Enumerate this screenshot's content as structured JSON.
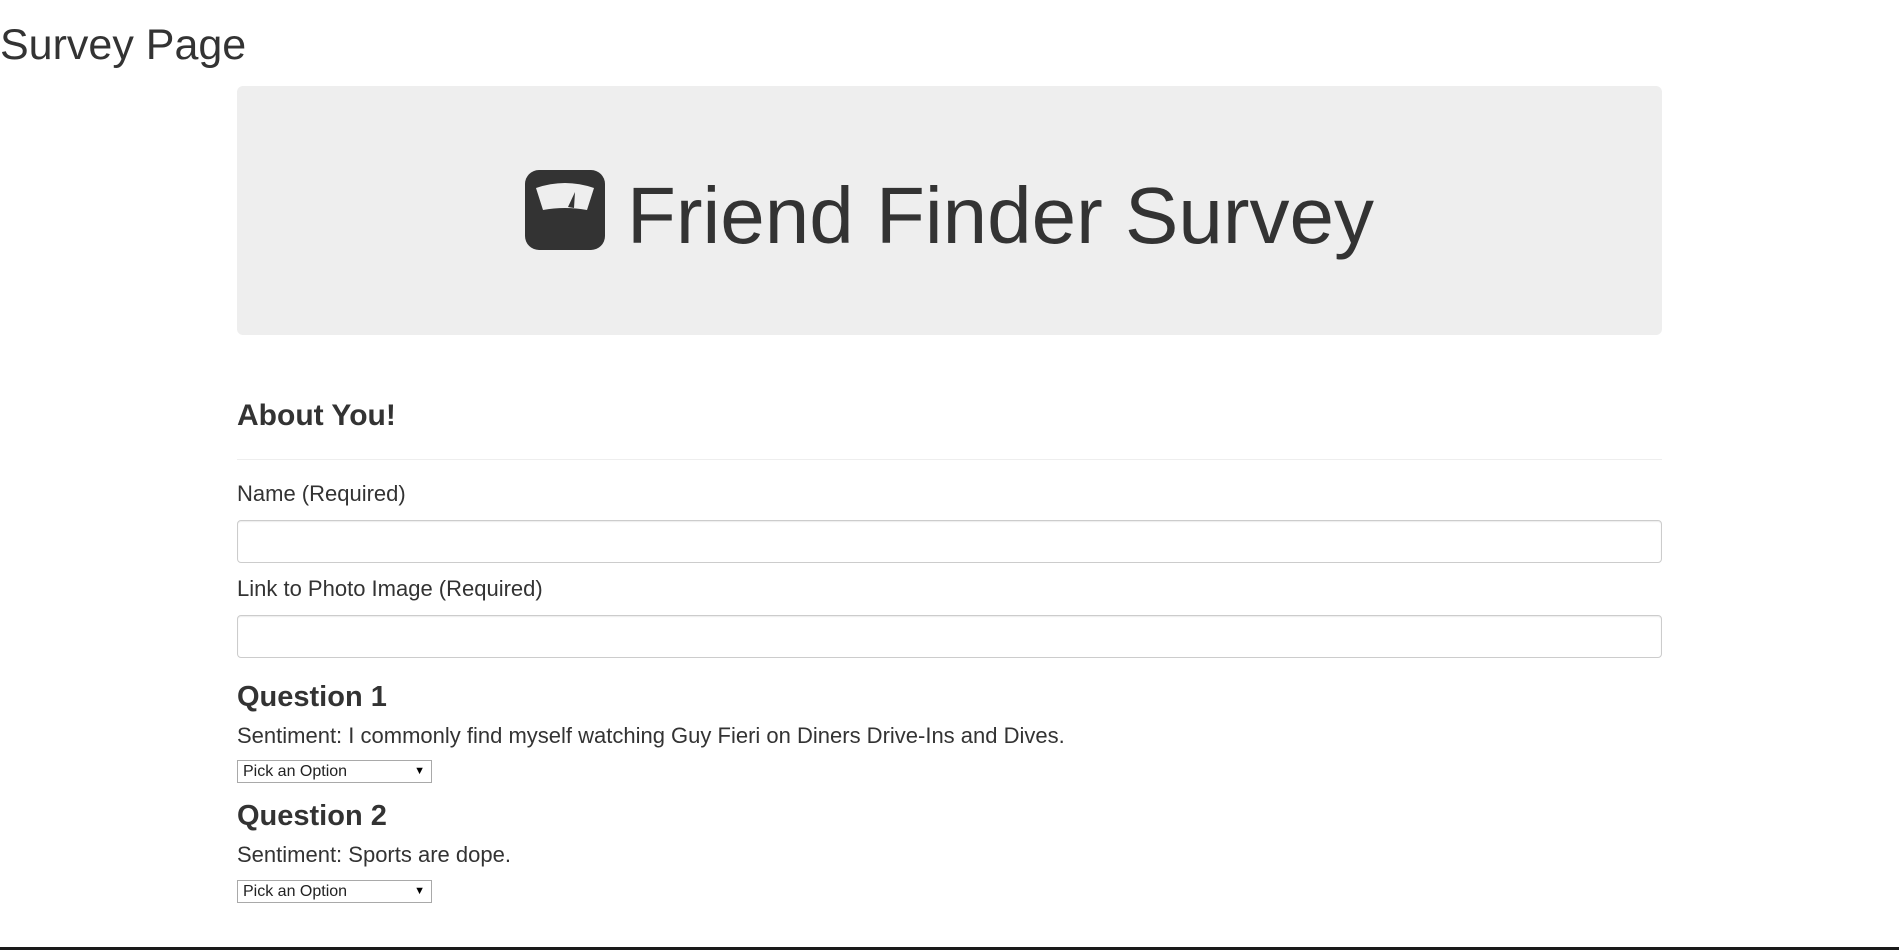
{
  "page": {
    "title": "Survey Page"
  },
  "jumbotron": {
    "icon": "scale-icon",
    "title": "Friend Finder Survey"
  },
  "about": {
    "heading": "About You!",
    "name_label": "Name (Required)",
    "name_value": "",
    "photo_label": "Link to Photo Image (Required)",
    "photo_value": ""
  },
  "questions": [
    {
      "heading": "Question 1",
      "sentiment": "Sentiment: I commonly find myself watching Guy Fieri on Diners Drive-Ins and Dives.",
      "selected": "Pick an Option"
    },
    {
      "heading": "Question 2",
      "sentiment": "Sentiment: Sports are dope.",
      "selected": "Pick an Option"
    }
  ],
  "colors": {
    "text": "#333333",
    "jumbotron_bg": "#eeeeee",
    "input_border": "#cccccc"
  }
}
